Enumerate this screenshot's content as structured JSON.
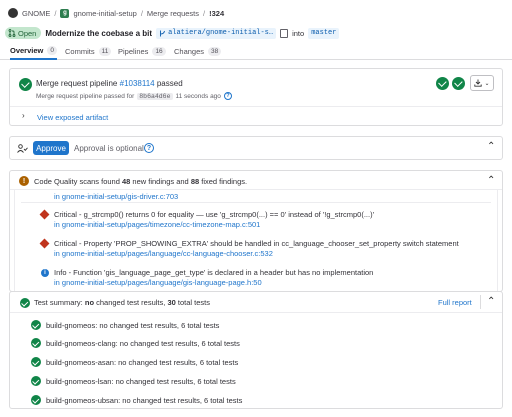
{
  "breadcrumb": {
    "group": "GNOME",
    "project": "gnome-initial-setup",
    "section": "Merge requests",
    "current": "!324"
  },
  "mr": {
    "state": "Open",
    "title": "Modernize the coebase a bit",
    "source_branch": "alatiera/gnome-initial-s…",
    "into": "into",
    "target_branch": "master"
  },
  "tabs": [
    {
      "label": "Overview",
      "count": "0"
    },
    {
      "label": "Commits",
      "count": "11"
    },
    {
      "label": "Pipelines",
      "count": "16"
    },
    {
      "label": "Changes",
      "count": "38"
    }
  ],
  "pipeline": {
    "prefix": "Merge request pipeline",
    "id": "#1038114",
    "status": "passed",
    "sub_prefix": "Merge request pipeline passed for",
    "sha": "8b6a4d6e",
    "time": "11 seconds ago",
    "artifact_link": "View exposed artifact"
  },
  "approval": {
    "button": "Approve",
    "text": "Approval is optional"
  },
  "code_quality": {
    "text_a": "Code Quality scans found",
    "new_count": "48",
    "text_b": "new findings and",
    "fixed_count": "88",
    "text_c": "fixed findings.",
    "findings": [
      {
        "severity": "",
        "line1": "",
        "file": "in gnome-initial-setup/gis-driver.c:703"
      },
      {
        "severity": "critical",
        "line1": "Critical - g_strcmp0() returns 0 for equality — use 'g_strcmp0(...) == 0' instead of '!g_strcmp0(...)'",
        "file": "in gnome-initial-setup/pages/timezone/cc-timezone-map.c:501"
      },
      {
        "severity": "critical",
        "line1": "Critical - Property 'PROP_SHOWING_EXTRA' should be handled in cc_language_chooser_set_property switch statement",
        "file": "in gnome-initial-setup/pages/language/cc-language-chooser.c:532"
      },
      {
        "severity": "info",
        "line1": "Info - Function 'gis_language_page_get_type' is declared in a header but has no implementation",
        "file": "in gnome-initial-setup/pages/language/gis-language-page.h:50"
      }
    ]
  },
  "tests": {
    "prefix": "Test summary:",
    "bold_a": "no",
    "mid": "changed test results,",
    "bold_b": "30",
    "suffix": "total tests",
    "full_report": "Full report",
    "jobs": [
      "build-gnomeos: no changed test results, 6 total tests",
      "build-gnomeos-clang: no changed test results, 6 total tests",
      "build-gnomeos-asan: no changed test results, 6 total tests",
      "build-gnomeos-lsan: no changed test results, 6 total tests",
      "build-gnomeos-ubsan: no changed test results, 6 total tests"
    ]
  },
  "colors": {
    "success": "#108548",
    "link": "#1f75cb",
    "critical": "#c0341d",
    "warning": "#ab6100"
  }
}
